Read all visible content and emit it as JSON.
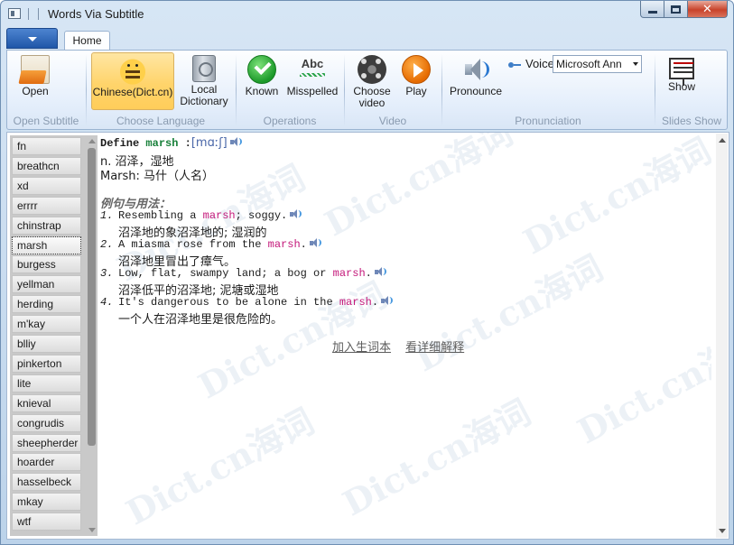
{
  "window": {
    "title": "Words Via Subtitle"
  },
  "ribbon": {
    "tab_home": "Home",
    "groups": {
      "open_subtitle": {
        "label": "Open Subtitle",
        "open": "Open"
      },
      "choose_language": {
        "label": "Choose Language",
        "chinese": "Chinese(Dict.cn)",
        "local_dict_line1": "Local",
        "local_dict_line2": "Dictionary"
      },
      "operations": {
        "label": "Operations",
        "known": "Known",
        "misspelled": "Misspelled",
        "misspelled_icon_text": "Abc"
      },
      "video": {
        "label": "Video",
        "choose_video_line1": "Choose",
        "choose_video_line2": "video",
        "play": "Play"
      },
      "pronunciation": {
        "label": "Pronunciation",
        "pronounce": "Pronounce",
        "voice_label": "Voice",
        "voice_value": "Microsoft Ann"
      },
      "slides_show": {
        "label": "Slides Show",
        "show": "Show"
      }
    }
  },
  "word_list": [
    "fn",
    "breathcn",
    "xd",
    "errrr",
    "chinstrap",
    "marsh",
    "burgess",
    "yellman",
    "herding",
    "m'kay",
    "blliy",
    "pinkerton",
    "lite",
    "knieval",
    "congrudis",
    "sheepherder",
    "hoarder",
    "hasselbeck",
    "mkay",
    "wtf"
  ],
  "selected_word": "marsh",
  "definition": {
    "define_prefix": "Define ",
    "word": "marsh",
    "colon": " :",
    "phonetic": "[mɑːʃ]",
    "sense_1": "n. 沼泽，湿地",
    "sense_2": "Marsh: 马什（人名）",
    "examples_heading": "例句与用法：",
    "examples": [
      {
        "num": "1.",
        "pre": "Resembling a ",
        "hl": "marsh",
        "post": "; soggy.",
        "zh": "沼泽地的象沼泽地的; 湿润的"
      },
      {
        "num": "2.",
        "pre": "A miasma rose from the ",
        "hl": "marsh",
        "post": ".",
        "zh": "沼泽地里冒出了瘴气。"
      },
      {
        "num": "3.",
        "pre": "Low, flat, swampy land; a bog or ",
        "hl": "marsh",
        "post": ".",
        "zh": "沼泽低平的沼泽地; 泥塘或湿地"
      },
      {
        "num": "4.",
        "pre": "It's dangerous to be alone in the ",
        "hl": "marsh",
        "post": ".",
        "zh": "一个人在沼泽地里是很危险的。"
      }
    ],
    "link_add": "加入生词本",
    "link_detail": "看详细解释",
    "watermark": "Dict.cn海词"
  },
  "colors": {
    "accent": "#1f56a8",
    "active_button": "#ffd46b",
    "keyword": "#18803a",
    "highlight": "#c4187a"
  },
  "icons": [
    "open-file-icon",
    "bee-icon",
    "hard-disk-icon",
    "check-icon",
    "spellcheck-icon",
    "film-reel-icon",
    "play-icon",
    "speaker-icon",
    "voice-icon",
    "slideshow-board-icon"
  ]
}
